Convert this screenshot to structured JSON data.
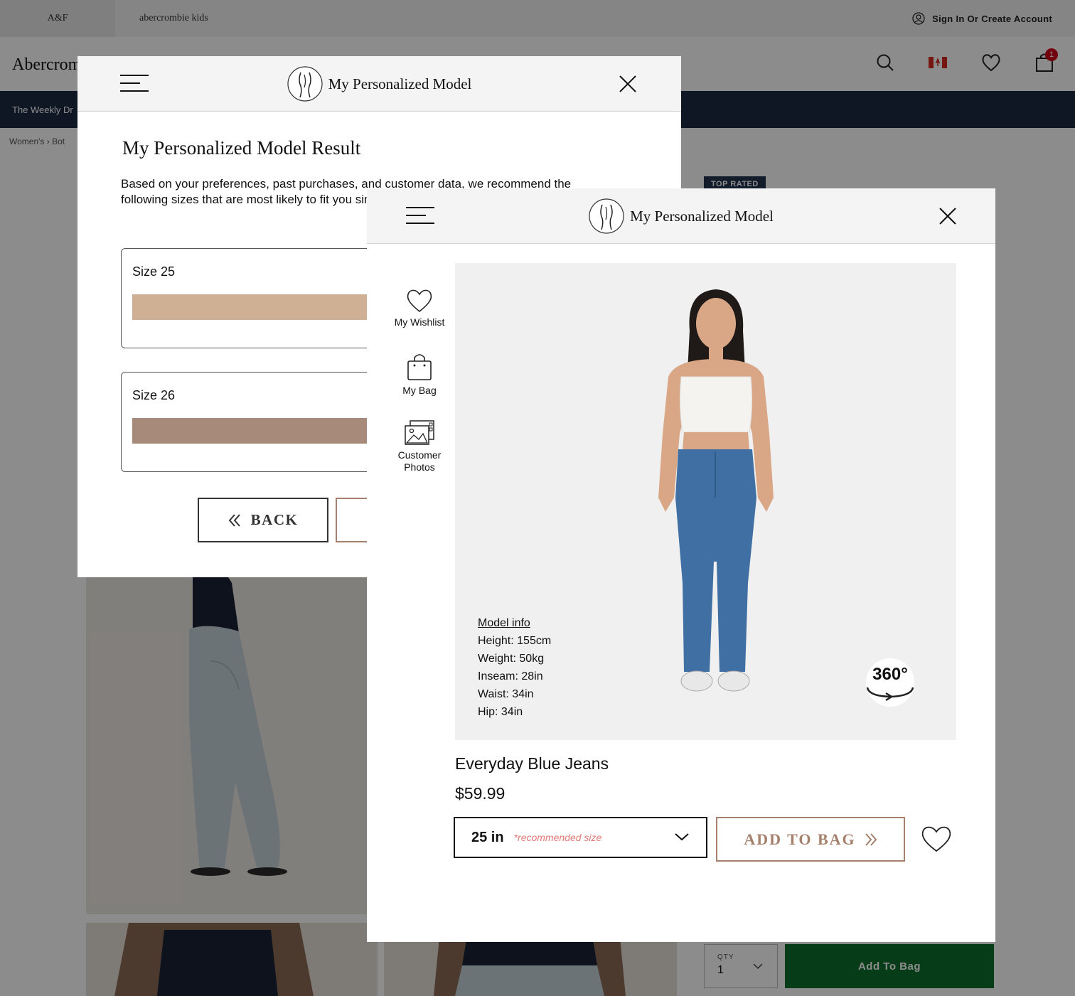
{
  "store": {
    "brand_tab": "A&F",
    "kids_tab": "abercrombie kids",
    "sign_in": "Sign In Or Create Account",
    "logo": "Abercrombie",
    "promo": "The Weekly Dr",
    "breadcrumb": "Women's  ›  Bot",
    "badge": "TOP RATED",
    "bag_count": "1",
    "qty_label": "QTY",
    "qty_value": "1",
    "add_to_bag": "Add To Bag"
  },
  "result_modal": {
    "title": "My Personalized Model",
    "heading": "My Personalized Model Result",
    "description": "Based on your preferences, past purchases, and customer data, we recommend the following sizes that are most likely to fit you similar body type for you to visualize the fit.",
    "sizes": [
      {
        "label": "Size 25",
        "color": "#cfb094"
      },
      {
        "label": "Size 26",
        "color": "#a88a7a"
      }
    ],
    "back_label": "BACK"
  },
  "model_modal": {
    "title": "My Personalized Model",
    "sidebar": [
      {
        "label": "My Wishlist",
        "icon": "heart-icon"
      },
      {
        "label": "My Bag",
        "icon": "bag-icon"
      },
      {
        "label": "Customer Photos",
        "icon": "photos-icon"
      }
    ],
    "model_info": {
      "title": "Model info",
      "height": "Height: 155cm",
      "weight": "Weight: 50kg",
      "inseam": "Inseam: 28in",
      "waist": "Waist: 34in",
      "hip": "Hip: 34in"
    },
    "badge_360": "360°",
    "product_name": "Everyday Blue Jeans",
    "price": "$59.99",
    "size_value": "25 in",
    "size_note": "*recommended size",
    "add_to_bag": "ADD TO BAG"
  },
  "colors": {
    "accent": "#a5806c",
    "recommend_red": "#e27b78",
    "promo_navy": "#1d2a44",
    "cta_green": "#0d6e2d"
  }
}
